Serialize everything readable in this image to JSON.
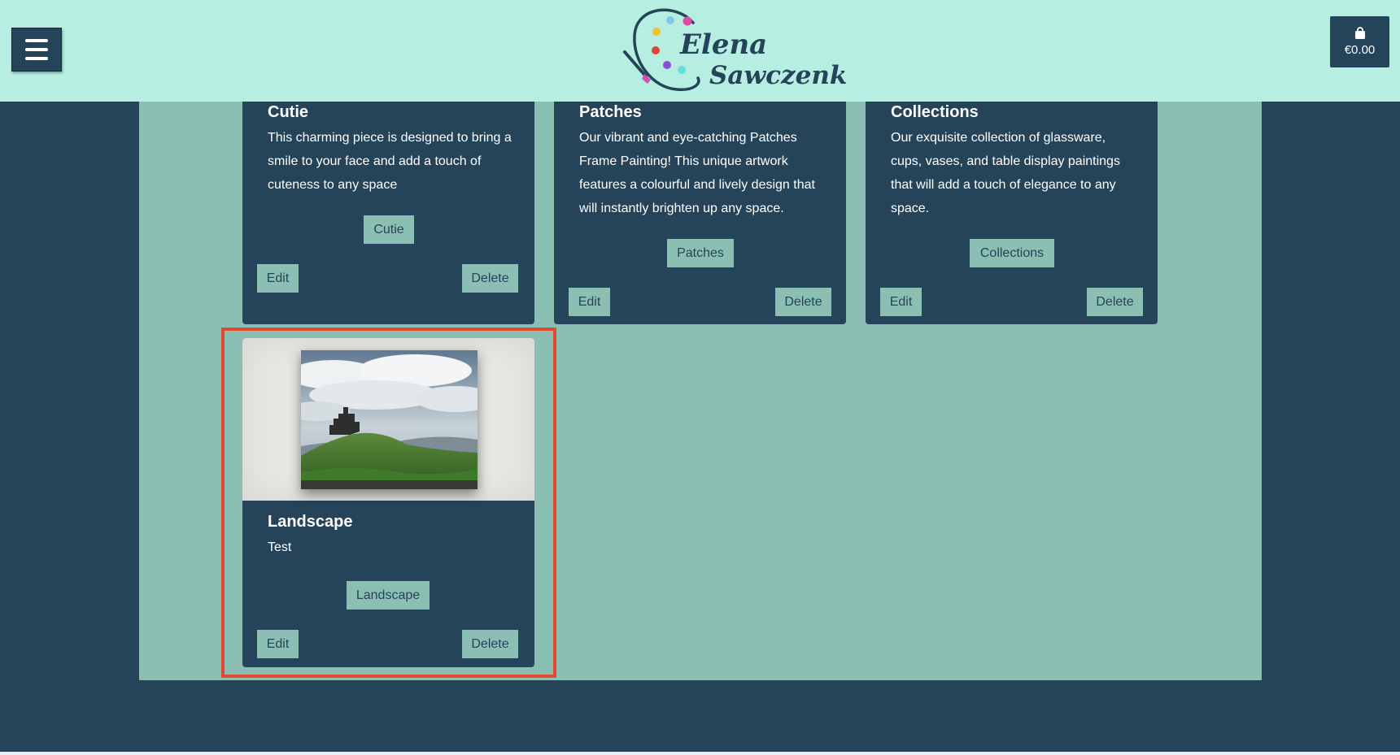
{
  "header": {
    "menu_icon": "hamburger-icon",
    "logo": {
      "line1": "Elena",
      "line2": "Sawczenko"
    },
    "cart": {
      "icon": "shopping-bag-icon",
      "total": "€0.00"
    }
  },
  "cards": [
    {
      "title": "Cutie",
      "description": "This charming piece is designed to bring a smile to your face and add a touch of cuteness to any space",
      "category_button": "Cutie",
      "edit_label": "Edit",
      "delete_label": "Delete"
    },
    {
      "title": "Patches",
      "description": "Our vibrant and eye-catching Patches Frame Painting! This unique artwork features a colourful and lively design that will instantly brighten up any space.",
      "category_button": "Patches",
      "edit_label": "Edit",
      "delete_label": "Delete"
    },
    {
      "title": "Collections",
      "description": "Our exquisite collection of glassware, cups, vases, and table display paintings that will add a touch of elegance to any space.",
      "category_button": "Collections",
      "edit_label": "Edit",
      "delete_label": "Delete"
    },
    {
      "title": "Landscape",
      "description": "Test",
      "category_button": "Landscape",
      "edit_label": "Edit",
      "delete_label": "Delete",
      "image": "castle-landscape-painting"
    }
  ],
  "colors": {
    "header_bg": "#b6efe1",
    "page_bg": "#254359",
    "panel_bg": "#8cbfb4",
    "button_bg": "#8cbfb4",
    "highlight": "#e24a33"
  }
}
